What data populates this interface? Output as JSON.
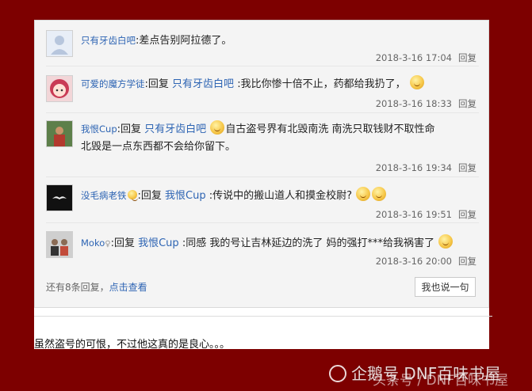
{
  "replies": [
    {
      "user": "只有牙齿白吧",
      "prefix": "",
      "target": "",
      "content": ":差点告别阿拉德了。",
      "time": "2018-3-16 17:04",
      "action": "回复",
      "avatar": "default-avatar"
    },
    {
      "user": "可爱的魔方学徒",
      "prefix": ":回复",
      "target": "只有牙齿白吧",
      "content": ":我比你惨十倍不止，药都给我扔了，",
      "time": "2018-3-16 18:33",
      "action": "回复",
      "avatar": "anime-girl-avatar"
    },
    {
      "user": "我恨Cup",
      "prefix": ":回复",
      "target": "只有牙齿白吧",
      "content": "自古盗号界有北毁南洗 南洗只取钱财不取性命",
      "content2": "北毁是一点东西都不会给你留下。",
      "time": "2018-3-16 19:34",
      "action": "回复",
      "avatar": "photo-avatar"
    },
    {
      "user": "没毛病老铁",
      "prefix": ":回复",
      "target": "我恨Cup",
      "content": ":传说中的搬山道人和摸金校尉?",
      "time": "2018-3-16 19:51",
      "action": "回复",
      "avatar": "mustache-avatar"
    },
    {
      "user": "Moko",
      "prefix": ":回复",
      "target": "我恨Cup",
      "content": ":同感 我的号让吉林延边的洗了 妈的强打***给我祸害了",
      "time": "2018-3-16 20:00",
      "action": "回复",
      "avatar": "group-avatar"
    }
  ],
  "footer": {
    "more_text": "还有8条回复，",
    "more_link": "点击查看",
    "say_button": "我也说一句"
  },
  "post_body": "虽然盗号的可恨，不过他这真的是良心。。。",
  "watermark": {
    "main": "企鹅号 DNF百味书屋",
    "sub": "头条号 / DNF百味书屋"
  },
  "colors": {
    "background": "#7d0000",
    "link": "#2d64b3"
  }
}
